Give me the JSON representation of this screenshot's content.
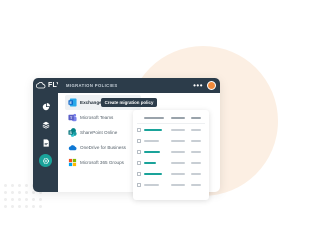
{
  "brand": {
    "logo_text": "FLY",
    "accent": "#1aa39a",
    "dark": "#2c3c4a"
  },
  "topbar": {
    "title": "MIGRATION POLICIES",
    "more_icon": "more-dots-icon",
    "avatar_color": "#f08a3c"
  },
  "sidebar": {
    "items": [
      {
        "name": "dashboard",
        "icon": "pie-chart-icon",
        "active": false
      },
      {
        "name": "layers",
        "icon": "layers-icon",
        "active": false
      },
      {
        "name": "reports",
        "icon": "document-icon",
        "active": false
      },
      {
        "name": "settings",
        "icon": "gear-icon",
        "active": true
      }
    ]
  },
  "sources": [
    {
      "label": "Exchange Online",
      "icon": "exchange-icon",
      "color": "#0a64c8",
      "selected": true
    },
    {
      "label": "Microsoft Teams",
      "icon": "teams-icon",
      "color": "#5b5fc7",
      "selected": false
    },
    {
      "label": "SharePoint Online",
      "icon": "sharepoint-icon",
      "color": "#0f7b83",
      "selected": false
    },
    {
      "label": "OneDrive for Business",
      "icon": "onedrive-icon",
      "color": "#0f78d4",
      "selected": false
    },
    {
      "label": "Microsoft 365 Groups",
      "icon": "groups-icon",
      "color": "#d43a3a",
      "selected": false
    }
  ],
  "actions": {
    "create_policy": "Create migration policy"
  }
}
